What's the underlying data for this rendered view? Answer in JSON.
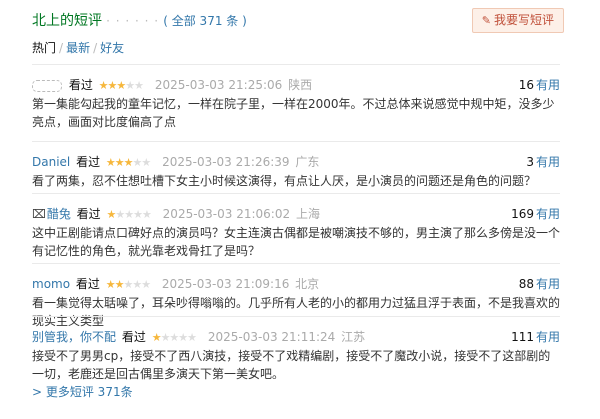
{
  "header": {
    "title": "北上的短评",
    "dots": "· · · · · ·",
    "count": "( 全部 371 条 )",
    "write_button": "我要写短评",
    "pen_icon": "pencil-icon"
  },
  "tabs": [
    {
      "label": "热门"
    },
    {
      "label": "最新"
    },
    {
      "label": "好友"
    }
  ],
  "comments": [
    {
      "user": "",
      "watched": "看过",
      "rating_stars": 3,
      "time": "2025-03-03 21:25:06",
      "location": "陕西",
      "votes": "16",
      "useful": "有用",
      "content": "第一集能勾起我的童年记忆，一样在院子里，一样在2000年。不过总体来说感觉中规中矩，没多少亮点，画面对比度偏高了点"
    },
    {
      "user": "Daniel",
      "watched": "看过",
      "rating_stars": 3,
      "time": "2025-03-03 21:26:39",
      "location": "广东",
      "votes": "3",
      "useful": "有用",
      "content": "看了两集，忍不住想吐槽下女主小时候这演得，有点让人厌，是小演员的问题还是角色的问题？"
    },
    {
      "user": "醋兔",
      "watched": "看过",
      "rating_stars": 1,
      "time": "2025-03-03 21:06:02",
      "location": "上海",
      "votes": "169",
      "useful": "有用",
      "content": "这中正剧能请点口碑好点的演员吗？女主连演古偶都是被嘲演技不够的，男主演了那么多傍是没一个有记忆性的角色，就光靠老戏骨扛了是吗？"
    },
    {
      "user": "momo",
      "watched": "看过",
      "rating_stars": 2,
      "time": "2025-03-03 21:09:16",
      "location": "北京",
      "votes": "88",
      "useful": "有用",
      "content": "看一集觉得太聒噪了，耳朵吵得嗡嗡的。几乎所有人老的小的都用力过猛且浮于表面，不是我喜欢的现实主义类型"
    },
    {
      "user": "别管我，你不配",
      "watched": "看过",
      "rating_stars": 1,
      "time": "2025-03-03 21:11:24",
      "location": "江苏",
      "votes": "111",
      "useful": "有用",
      "content": "接受不了男男cp，接受不了西八演技，接受不了戏精编剧，接受不了魔改小说，接受不了这部剧的一切，老鹿还是回古偶里多演天下第一美女吧。"
    }
  ],
  "more_link": "> 更多短评 371条"
}
